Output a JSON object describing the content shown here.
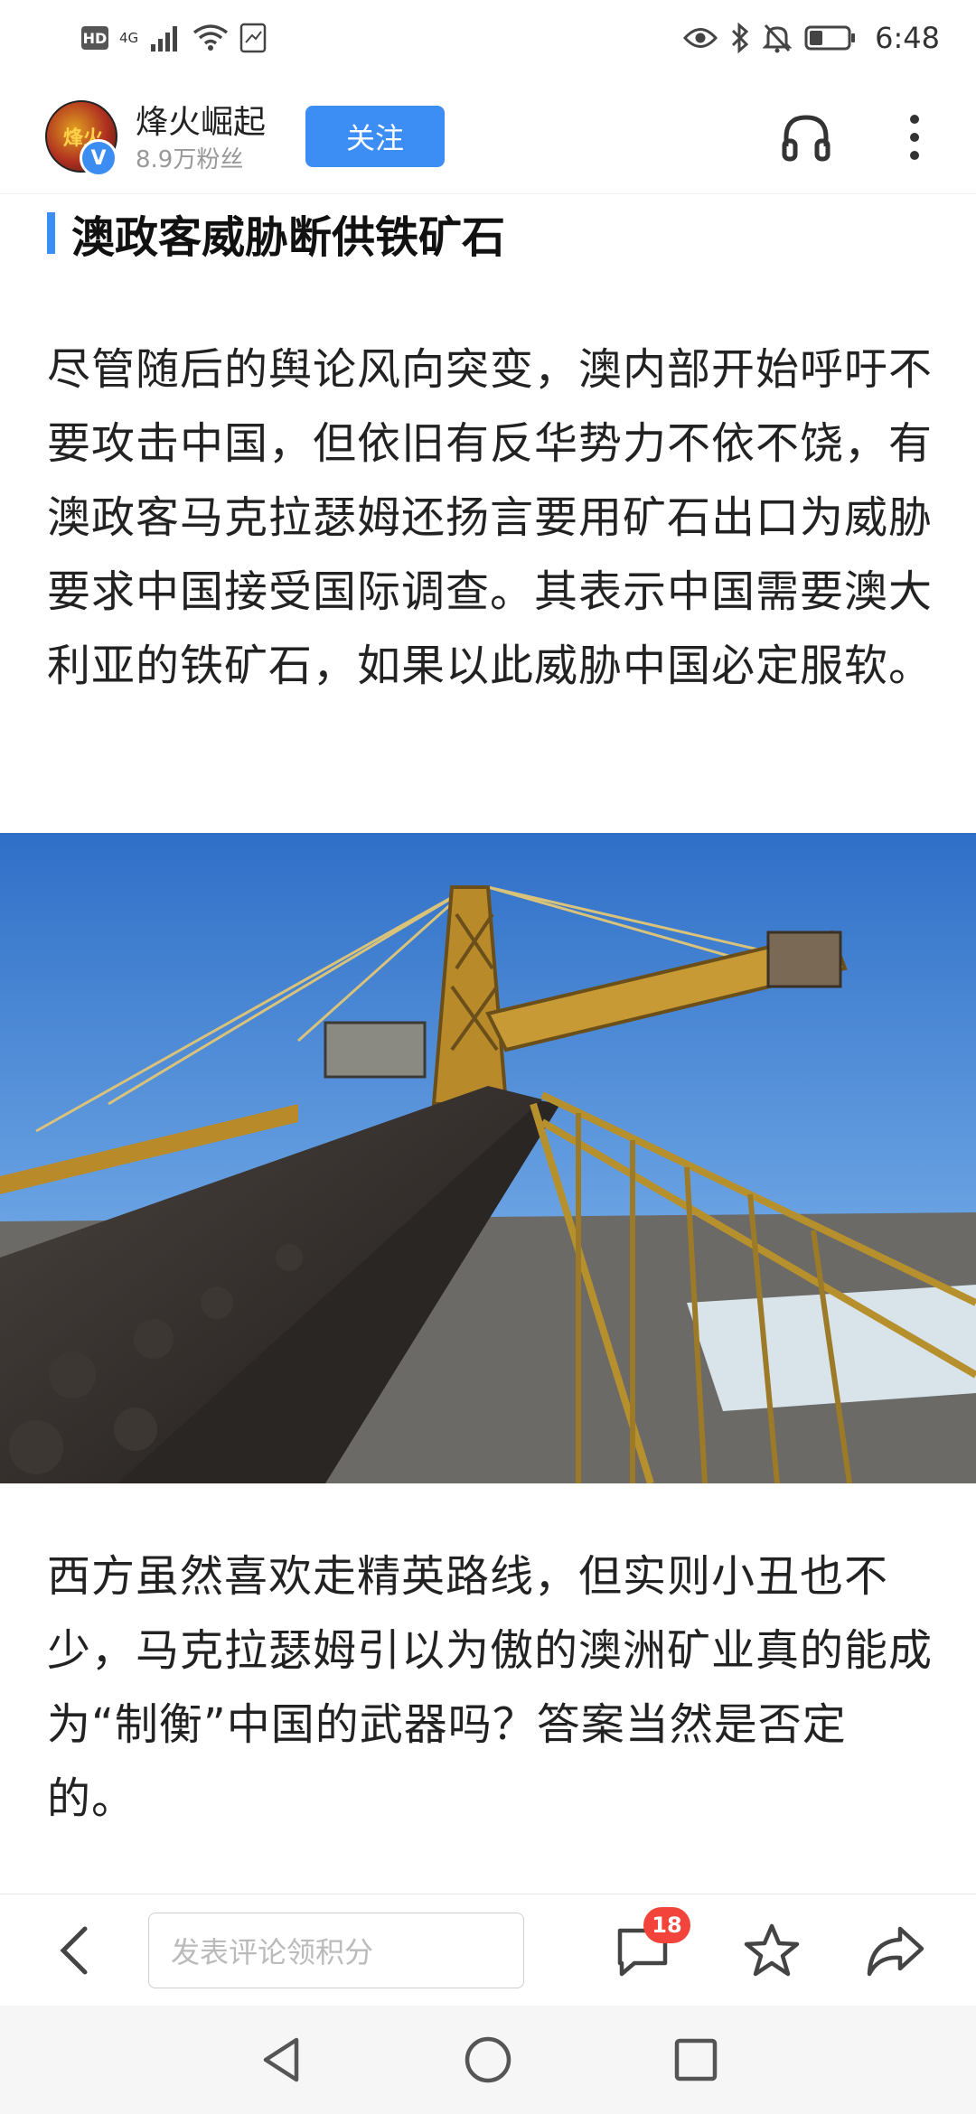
{
  "status_bar": {
    "hd_label": "HD",
    "network_label": "4G",
    "time": "6:48",
    "icons": [
      "signal-icon",
      "wifi-icon",
      "sim-icon",
      "eye-icon",
      "bluetooth-icon",
      "mute-icon",
      "battery-icon"
    ]
  },
  "header": {
    "author_name": "烽火崛起",
    "fans": "8.9万粉丝",
    "follow_label": "关注",
    "avatar_text": "烽火",
    "verified_mark": "V"
  },
  "article": {
    "section_title": "澳政客威胁断供铁矿石",
    "paragraph1": "尽管随后的舆论风向突变，澳内部开始呼吁不要攻击中国，但依旧有反华势力不依不饶，有澳政客马克拉瑟姆还扬言要用矿石出口为威胁要求中国接受国际调查。其表示中国需要澳大利亚的铁矿石，如果以此威胁中国必定服软。",
    "paragraph2": "西方虽然喜欢走精英路线，但实则小丑也不少，马克拉瑟姆引以为傲的澳洲矿业真的能成为“制衡”中国的武器吗？答案当然是否定的。"
  },
  "toolbar": {
    "comment_placeholder": "发表评论领积分",
    "comment_count": "18"
  },
  "colors": {
    "accent": "#3d8ef4",
    "badge": "#f2443a"
  }
}
